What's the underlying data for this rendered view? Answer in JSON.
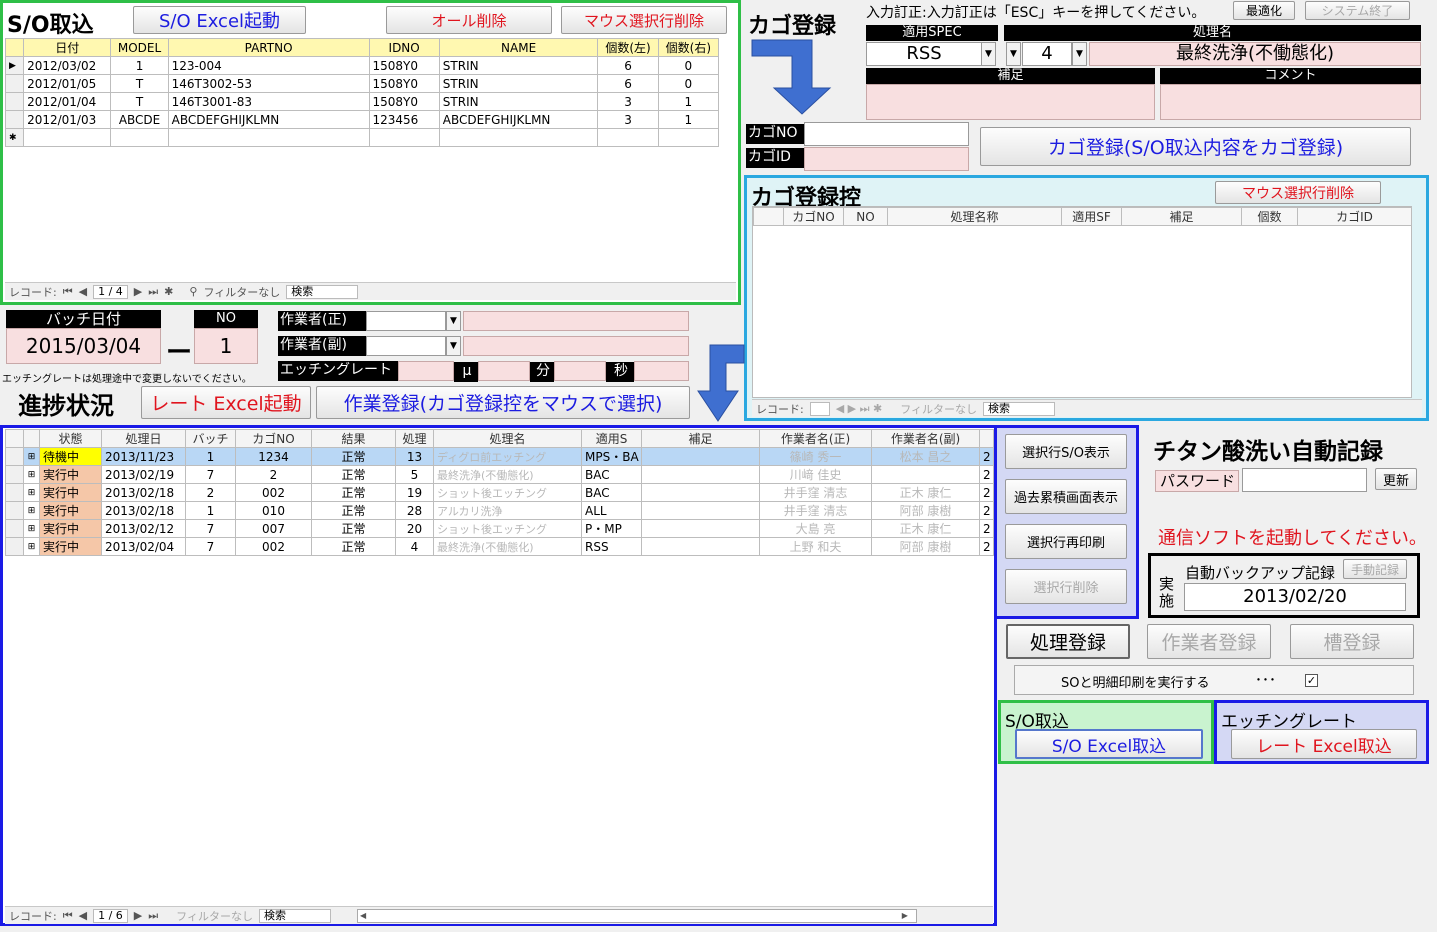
{
  "so": {
    "title": "S/O取込",
    "excel_btn": "S/O Excel起動",
    "clear_all": "オール削除",
    "delete_sel": "マウス選択行削除",
    "columns": [
      "日付",
      "MODEL",
      "PARTNO",
      "IDNO",
      "NAME",
      "個数(左)",
      "個数(右)"
    ],
    "rows": [
      [
        "2012/03/02",
        "1",
        "123-004",
        "1508Y0",
        "STRIN",
        "6",
        "0"
      ],
      [
        "2012/01/05",
        "T",
        "146T3002-53",
        "1508Y0",
        "STRIN",
        "6",
        "0"
      ],
      [
        "2012/01/04",
        "T",
        "146T3001-83",
        "1508Y0",
        "STRIN",
        "3",
        "1"
      ],
      [
        "2012/01/03",
        "ABCDE",
        "ABCDEFGHIJKLMN",
        "123456",
        "ABCDEFGHIJKLMN",
        "3",
        "1"
      ]
    ],
    "nav": {
      "record": "レコード:",
      "pos": "1 / 4",
      "filter": "フィルターなし",
      "search": "検索"
    }
  },
  "kago": {
    "title": "カゴ登録",
    "hint": "入力訂正:入力訂正は「ESC」キーを押してください。",
    "optimize": "最適化",
    "sys_exit": "システム終了",
    "spec_label": "適用SPEC",
    "spec_value": "RSS",
    "proc_label": "処理名",
    "proc_num": "4",
    "proc_value": "最終洗浄(不働態化)",
    "note_label": "補足",
    "comment_label": "コメント",
    "kago_no": "カゴNO",
    "kago_id": "カゴID",
    "register_btn": "カゴ登録(S/O取込内容をカゴ登録)"
  },
  "kagoctl": {
    "title": "カゴ登録控",
    "delete_sel": "マウス選択行削除",
    "columns": [
      "カゴNO",
      "NO",
      "処理名称",
      "適用SF",
      "補足",
      "個数",
      "カゴID"
    ],
    "nav": {
      "record": "レコード:",
      "filter": "フィルターなし",
      "search": "検索"
    }
  },
  "batch": {
    "date_label": "バッチ日付",
    "date": "2015/03/04",
    "no_label": "NO",
    "no": "1",
    "dash": "ー",
    "worker_main": "作業者(正)",
    "worker_sub": "作業者(副)",
    "etching": "エッチングレート",
    "mu": "μ",
    "min": "分",
    "sec": "秒",
    "warning": "エッチングレートは処理途中で変更しないでください。"
  },
  "progress": {
    "title": "進捗状況",
    "rate_btn": "レート Excel起動",
    "work_btn": "作業登録(カゴ登録控をマウスで選択)",
    "columns": [
      "状態",
      "処理日",
      "バッチ",
      "カゴNO",
      "結果",
      "処理",
      "処理名",
      "適用S",
      "補足",
      "作業者名(正)",
      "作業者名(副)"
    ],
    "rows": [
      {
        "status": "待機中",
        "date": "2013/11/23",
        "batch": "1",
        "kago": "1234",
        "result": "正常",
        "proc": "13",
        "name": "ディグロ前エッチング",
        "spec": "MPS・BA",
        "w1": "篠崎 秀一",
        "w2": "松本 昌之"
      },
      {
        "status": "実行中",
        "date": "2013/02/19",
        "batch": "7",
        "kago": "2",
        "result": "正常",
        "proc": "5",
        "name": "最終洗浄(不働態化)",
        "spec": "BAC",
        "w1": "川﨑 佳史",
        "w2": ""
      },
      {
        "status": "実行中",
        "date": "2013/02/18",
        "batch": "2",
        "kago": "002",
        "result": "正常",
        "proc": "19",
        "name": "ショット後エッチング",
        "spec": "BAC",
        "w1": "井手窪 清志",
        "w2": "正木 康仁"
      },
      {
        "status": "実行中",
        "date": "2013/02/18",
        "batch": "1",
        "kago": "010",
        "result": "正常",
        "proc": "28",
        "name": "アルカリ洗浄",
        "spec": "ALL",
        "w1": "井手窪 清志",
        "w2": "阿部 康樹"
      },
      {
        "status": "実行中",
        "date": "2013/02/12",
        "batch": "7",
        "kago": "007",
        "result": "正常",
        "proc": "20",
        "name": "ショット後エッチング",
        "spec": "P・MP",
        "w1": "大島 亮",
        "w2": "正木 康仁"
      },
      {
        "status": "実行中",
        "date": "2013/02/04",
        "batch": "7",
        "kago": "002",
        "result": "正常",
        "proc": "4",
        "name": "最終洗浄(不働態化)",
        "spec": "RSS",
        "w1": "上野 和夫",
        "w2": "阿部 康樹"
      }
    ],
    "nav": {
      "record": "レコード:",
      "pos": "1 / 6",
      "filter": "フィルターなし",
      "search": "検索"
    }
  },
  "side": {
    "show_so": "選択行S/O表示",
    "history": "過去累積画面表示",
    "reprint": "選択行再印刷",
    "delete": "選択行削除"
  },
  "auto": {
    "title": "チタン酸洗い自動記録",
    "password": "パスワード",
    "update": "更新",
    "comm_warn": "通信ソフトを起動してください。",
    "backup": "自動バックアップ記録",
    "manual": "手動記録",
    "done": "実施",
    "backup_date": "2013/02/20"
  },
  "bottom": {
    "proc_reg": "処理登録",
    "worker_reg": "作業者登録",
    "tank_reg": "槽登録",
    "print_label": "SOと明細印刷を実行する",
    "dots": "･･･",
    "so_title": "S/O取込",
    "so_btn": "S/O Excel取込",
    "etch_title": "エッチングレート",
    "etch_btn": "レート Excel取込"
  },
  "colors": {
    "green": "#2fbf47",
    "blue": "#1a1ae6",
    "cyan": "#2aa8e0",
    "pink": "#f8dfe0",
    "yellow": "#ffff00",
    "orange": "#f5c7a8"
  }
}
